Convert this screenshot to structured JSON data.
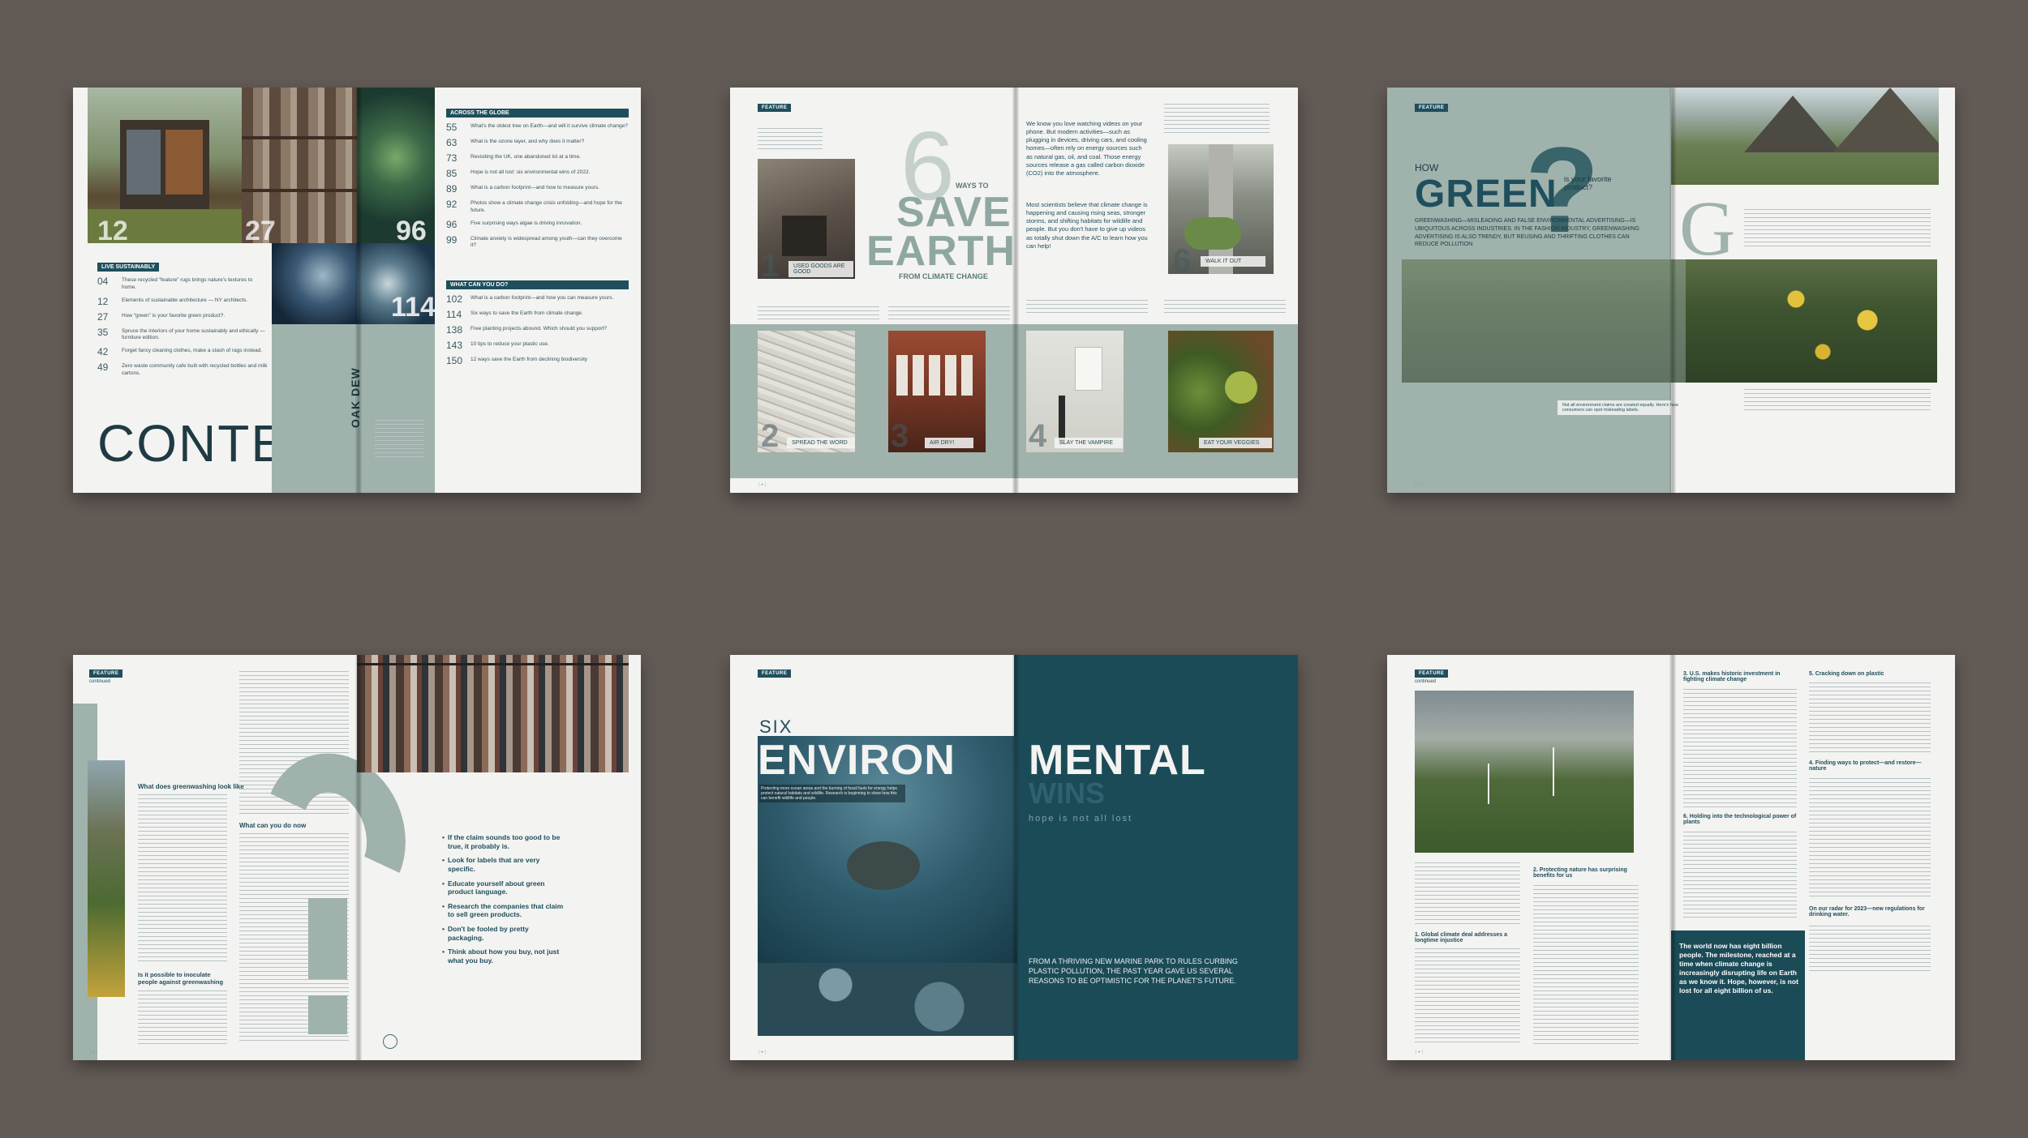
{
  "spread1": {
    "image_numbers": [
      "12",
      "27",
      "96",
      "114"
    ],
    "title": "CONTENT",
    "vertical_text": "OAK DEW",
    "live_sustainably": {
      "heading": "LIVE SUSTAINABLY",
      "items": [
        {
          "num": "04",
          "text": "These recycled “feature” rugs brings nature's textures to home."
        },
        {
          "num": "12",
          "text": "Elements of sustainable architecture — NY architects."
        },
        {
          "num": "27",
          "text": "How “green” is your favorite green product?."
        },
        {
          "num": "35",
          "text": "Spruce the interiors of your home sustainably and ethically — furniture edition."
        },
        {
          "num": "42",
          "text": "Forget fancy cleaning clothes, make a stash of rags instead."
        },
        {
          "num": "49",
          "text": "Zero waste community cafe built with recycled bottles and milk cartons."
        }
      ]
    },
    "across_globe": {
      "heading": "ACROSS THE GLOBE",
      "items": [
        {
          "num": "55",
          "text": "What's the oldest tree on Earth—and will it survive climate change?"
        },
        {
          "num": "63",
          "text": "What is the ozone layer, and why does it matter?"
        },
        {
          "num": "73",
          "text": "Revisiting the UK, one abandoned lot at a time."
        },
        {
          "num": "85",
          "text": "Hope is not all lost: six environmental wins of 2022."
        },
        {
          "num": "89",
          "text": "What is a carbon footprint—and how to measure yours."
        },
        {
          "num": "92",
          "text": "Photos show a climate change crisis unfolding—and hope for the future."
        },
        {
          "num": "96",
          "text": "Five surprising ways algae is driving innovation."
        },
        {
          "num": "99",
          "text": "Climate anxiety is widespread among youth—can they overcome it?"
        }
      ]
    },
    "what_can_you_do": {
      "heading": "WHAT CAN YOU DO?",
      "items": [
        {
          "num": "102",
          "text": "What is a carbon footprint—and how you can measure yours."
        },
        {
          "num": "114",
          "text": "Six ways to save the Earth from climate change."
        },
        {
          "num": "138",
          "text": "Free planting projects abound. Which should you support?"
        },
        {
          "num": "143",
          "text": "10 tips to reduce your plastic use."
        },
        {
          "num": "150",
          "text": "12 ways save the Earth from declining biodiversity"
        }
      ]
    }
  },
  "spread2": {
    "tag": "FEATURE",
    "big_six": "6",
    "ways_to": "WAYS TO",
    "save": "SAVE",
    "earth": "EARTH",
    "from": "FROM CLIMATE CHANGE",
    "intro": "We know you love watching videos on your phone. But modern activities—such as plugging in devices, driving cars, and cooling homes—often rely on energy sources such as natural gas, oil, and coal. Those energy sources release a gas called carbon dioxide (CO2) into the atmosphere.",
    "intro2": "Most scientists believe that climate change is happening and causing rising seas, stronger storms, and shifting habitats for wildlife and people. But you don't have to give up videos as totally shut down the A/C to learn how you can help!",
    "ways": [
      {
        "num": "1",
        "label": "USED GOODS ARE GOOD"
      },
      {
        "num": "2",
        "label": "SPREAD THE WORD"
      },
      {
        "num": "3",
        "label": "AIR DRY!"
      },
      {
        "num": "4",
        "label": "SLAY THE VAMPIRE"
      },
      {
        "num": "5",
        "label": "EAT YOUR VEGGIES"
      },
      {
        "num": "6",
        "label": "WALK IT OUT"
      }
    ]
  },
  "spread3": {
    "tag": "FEATURE",
    "how": "HOW",
    "green": "GREEN",
    "qmark": "?",
    "subtitle": "is your favorite product?",
    "deck": "GREENWASHING—MISLEADING AND FALSE ENVIRONMENTAL ADVERTISING—IS UBIQUITOUS ACROSS INDUSTRIES. IN THE FASHION INDUSTRY, GREENWASHING ADVERTISING IS ALSO TRENDY, BUT REUSING AND THRIFTING CLOTHES CAN REDUCE POLLUTION.",
    "dropcap": "G",
    "caption": "Not all environment claims are created equally. Here's how consumers can spot misleading labels."
  },
  "spread4": {
    "tag": "FEATURE",
    "continued": "continued",
    "heading1": "What does greenwashing look like",
    "heading2": "What can you do now",
    "heading3": "Is it possible to inoculate people against greenwashing",
    "bullets": [
      "If the claim sounds too good to be true, it probably is.",
      "Look for labels that are very specific.",
      "Educate yourself about green product language.",
      "Research the companies that claim to sell green products.",
      "Don't be fooled by pretty packaging.",
      "Think about how you buy, not just what you buy."
    ]
  },
  "spread5": {
    "tag": "FEATURE",
    "six": "SIX",
    "environ": "ENVIRON",
    "mental": "MENTAL",
    "wins": "WINS",
    "tagline": "hope is not all lost",
    "photo_caption": "Protecting more ocean areas and the burning of fossil fuels for energy helps protect natural habitats and wildlife. Research is beginning to show how this can benefit wildlife and people.",
    "deck": "FROM A THRIVING NEW MARINE PARK TO RULES CURBING PLASTIC POLLUTION, THE PAST YEAR GAVE US SEVERAL REASONS TO BE OPTIMISTIC FOR THE PLANET'S FUTURE."
  },
  "spread6": {
    "tag": "FEATURE",
    "continued": "continued",
    "headings": [
      "1. Global climate deal addresses a longtime injustice",
      "2. Protecting nature has surprising benefits for us",
      "3. U.S. makes historic investment in fighting climate change",
      "4. Finding ways to protect—and restore—nature",
      "5. Cracking down on plastic",
      "6. Holding into the technological power of plants",
      "On our radar for 2023—new regulations for drinking water."
    ],
    "quote": "The world now has eight billion people. The milestone, reached at a time when climate change is increasingly disrupting life on Earth as we know it. Hope, however, is not lost for all eight billion of us."
  }
}
